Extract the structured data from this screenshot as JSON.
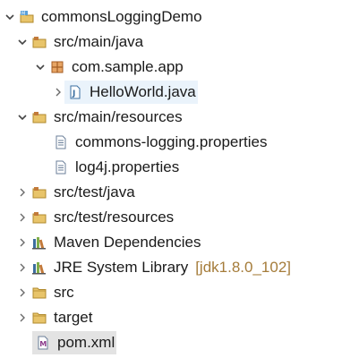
{
  "tree": {
    "project": {
      "label": "commonsLoggingDemo",
      "expanded": true
    },
    "src_main_java": {
      "label": "src/main/java",
      "expanded": true
    },
    "package_app": {
      "label": "com.sample.app",
      "expanded": true
    },
    "helloworld": {
      "label": "HelloWorld.java",
      "expanded": false
    },
    "src_main_resources": {
      "label": "src/main/resources",
      "expanded": true
    },
    "commons_props": {
      "label": "commons-logging.properties"
    },
    "log4j_props": {
      "label": "log4j.properties"
    },
    "src_test_java": {
      "label": "src/test/java",
      "expanded": false
    },
    "src_test_resources": {
      "label": "src/test/resources",
      "expanded": false
    },
    "maven_deps": {
      "label": "Maven Dependencies",
      "expanded": false
    },
    "jre_lib": {
      "label": "JRE System Library",
      "decoration": "[jdk1.8.0_102]",
      "expanded": false
    },
    "src": {
      "label": "src",
      "expanded": false
    },
    "target": {
      "label": "target",
      "expanded": false
    },
    "pom": {
      "label": "pom.xml"
    }
  },
  "icons": {
    "project": "maven-project-icon",
    "source_folder": "source-folder-icon",
    "package": "package-icon",
    "java_file": "java-file-icon",
    "properties_file": "properties-file-icon",
    "library": "library-icon",
    "folder": "folder-icon",
    "xml_file": "maven-pom-icon"
  },
  "colors": {
    "decoration_text": "#a57c3a",
    "selection_file": "#eaf3fb",
    "selection_pom": "#e3e3e3",
    "folder": "#e8c46a",
    "package": "#c27a3a"
  }
}
